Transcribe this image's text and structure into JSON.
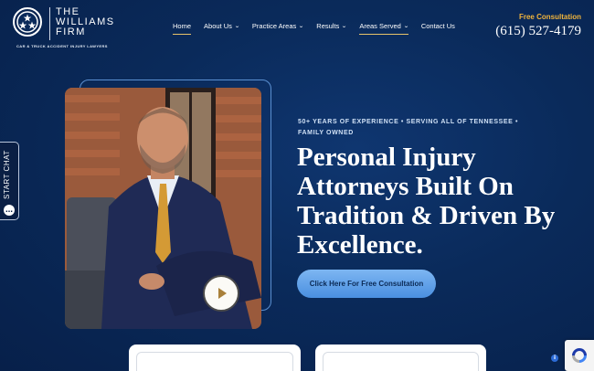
{
  "brand": {
    "name_line1": "THE",
    "name_line2": "WILLIAMS",
    "name_line3": "FIRM",
    "tagline": "CAR & TRUCK ACCIDENT INJURY LAWYERS",
    "seal_icon": "tennessee-tristar-icon"
  },
  "nav": {
    "items": [
      {
        "label": "Home",
        "dropdown": false,
        "active": true
      },
      {
        "label": "About Us",
        "dropdown": true,
        "active": false
      },
      {
        "label": "Practice Areas",
        "dropdown": true,
        "active": false
      },
      {
        "label": "Results",
        "dropdown": true,
        "active": false
      },
      {
        "label": "Areas Served",
        "dropdown": true,
        "active": true
      },
      {
        "label": "Contact Us",
        "dropdown": false,
        "active": false
      }
    ],
    "underline_color": "#e7c36a"
  },
  "header_cta": {
    "label": "Free Consultation",
    "phone": "(615) 527-4179",
    "label_color": "#f0b43c"
  },
  "chat": {
    "label": "START CHAT",
    "icon": "chat-bubble-icon"
  },
  "hero": {
    "eyebrow": "50+ YEARS OF EXPERIENCE • SERVING ALL OF TENNESSEE • FAMILY OWNED",
    "headline": "Personal Injury Attorneys Built On Tradition & Driven By Excellence.",
    "cta_label": "Click Here For Free Consultation",
    "play_icon": "play-icon"
  },
  "colors": {
    "background": "#0a2a5a",
    "accent_gold": "#e7c36a",
    "cta_blue": "#6aa8ee"
  }
}
